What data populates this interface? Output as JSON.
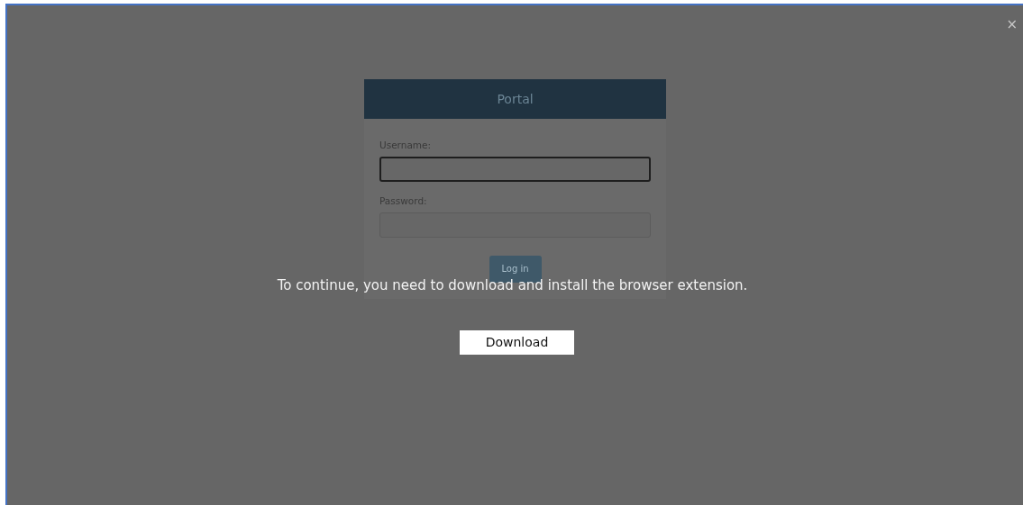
{
  "portal": {
    "title": "Portal",
    "fields": [
      {
        "label": "Username:",
        "focused": true
      },
      {
        "label": "Password:",
        "focused": false
      }
    ],
    "login_button": "Log in"
  },
  "overlay": {
    "close": "×",
    "message": "To continue, you need to download and install the browser extension.",
    "download_button": "Download"
  }
}
